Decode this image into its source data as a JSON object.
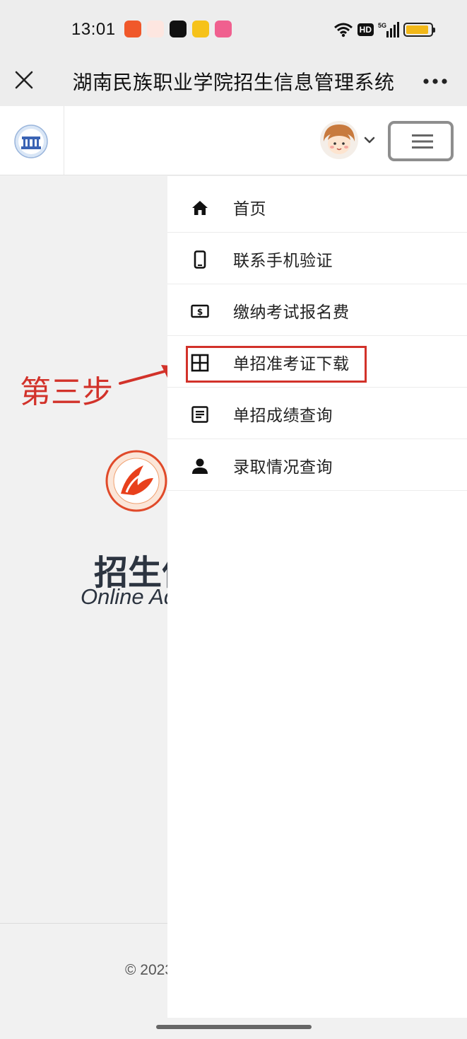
{
  "status_bar": {
    "time": "13:01",
    "network_badge": "HD",
    "network_type": "5G",
    "battery_level": 0.9,
    "notification_icons": [
      "video-app-icon",
      "game-app-icon",
      "douyin-app-icon",
      "notes-app-icon",
      "live-app-icon"
    ]
  },
  "title_bar": {
    "title": "湖南民族职业学院招生信息管理系统"
  },
  "page": {
    "hero_title": "招生信息",
    "hero_subtitle": "Online Admission",
    "copyright": "© 2023"
  },
  "annotation": {
    "step_label": "第三步",
    "color": "#d2322a"
  },
  "menu": {
    "items": [
      {
        "label": "首页",
        "icon": "home-icon"
      },
      {
        "label": "联系手机验证",
        "icon": "phone-icon"
      },
      {
        "label": "缴纳考试报名费",
        "icon": "payment-icon"
      },
      {
        "label": "单招准考证下载",
        "icon": "grid-icon"
      },
      {
        "label": "单招成绩查询",
        "icon": "document-icon"
      },
      {
        "label": "录取情况查询",
        "icon": "person-icon"
      }
    ],
    "highlighted_index": 3
  }
}
